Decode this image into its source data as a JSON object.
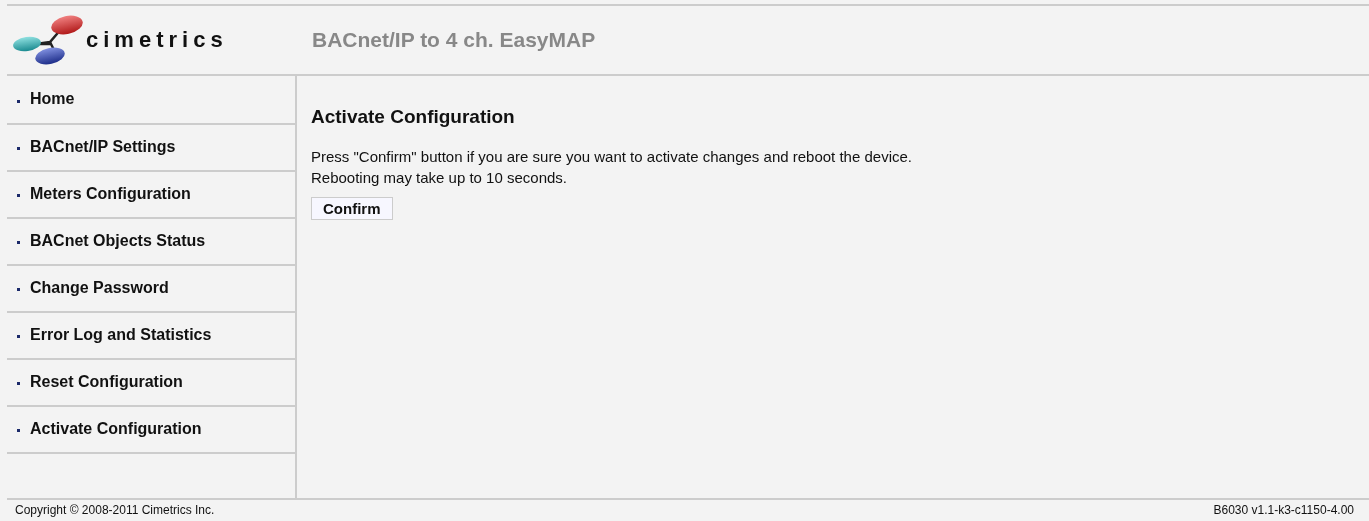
{
  "header": {
    "logo_text": "cimetrics",
    "title": "BACnet/IP to 4 ch. EasyMAP"
  },
  "sidebar": {
    "items": [
      {
        "label": "Home"
      },
      {
        "label": "BACnet/IP Settings"
      },
      {
        "label": "Meters Configuration"
      },
      {
        "label": "BACnet Objects Status"
      },
      {
        "label": "Change Password"
      },
      {
        "label": "Error Log and Statistics"
      },
      {
        "label": "Reset Configuration"
      },
      {
        "label": "Activate Configuration"
      }
    ]
  },
  "content": {
    "heading": "Activate Configuration",
    "lines": [
      "Press \"Confirm\" button if you are sure you want to activate changes and reboot the device.",
      "Rebooting may take up to 10 seconds."
    ],
    "button": "Confirm"
  },
  "footer": {
    "copyright": "Copyright © 2008-2011 Cimetrics Inc.",
    "version": "B6030 v1.1-k3-c1150-4.00"
  }
}
